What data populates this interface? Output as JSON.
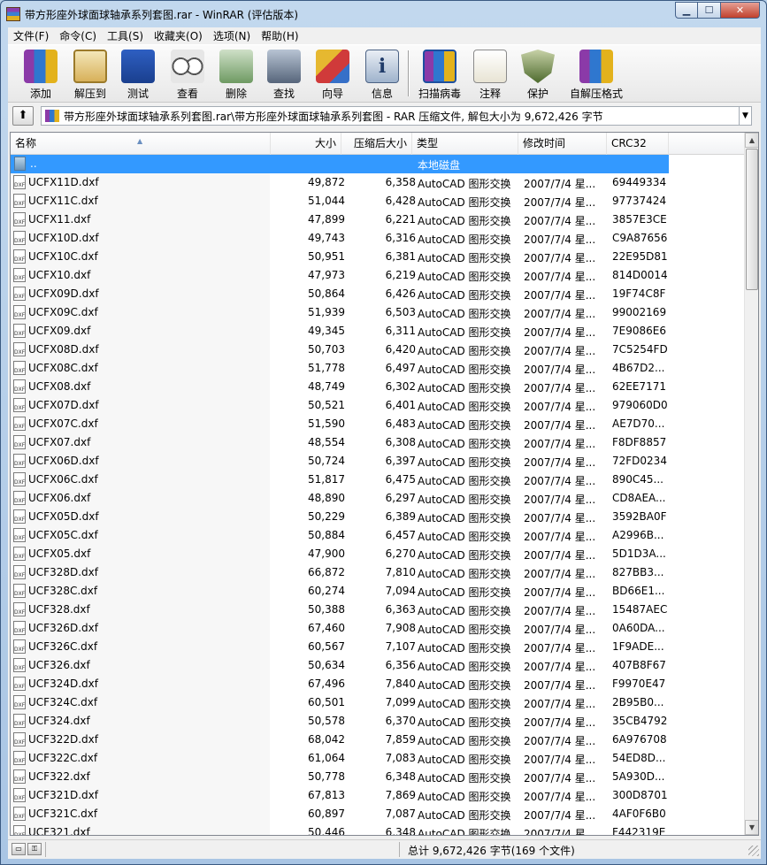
{
  "window": {
    "title": "带方形座外球面球轴承系列套图.rar - WinRAR (评估版本)",
    "controls": {
      "minimize": "▁",
      "maximize": "☐",
      "close": "✕"
    }
  },
  "menu": [
    "文件(F)",
    "命令(C)",
    "工具(S)",
    "收藏夹(O)",
    "选项(N)",
    "帮助(H)"
  ],
  "toolbar": [
    {
      "label": "添加",
      "icon": "add-archive-icon"
    },
    {
      "label": "解压到",
      "icon": "extract-folder-icon"
    },
    {
      "label": "测试",
      "icon": "test-archive-icon"
    },
    {
      "label": "查看",
      "icon": "view-glasses-icon"
    },
    {
      "label": "删除",
      "icon": "delete-recycle-icon"
    },
    {
      "label": "查找",
      "icon": "find-binoculars-icon"
    },
    {
      "label": "向导",
      "icon": "wizard-icon"
    },
    {
      "label": "信息",
      "icon": "info-icon"
    },
    {
      "label": "扫描病毒",
      "icon": "virus-scan-icon"
    },
    {
      "label": "注释",
      "icon": "comment-icon"
    },
    {
      "label": "保护",
      "icon": "protect-shield-icon"
    },
    {
      "label": "自解压格式",
      "icon": "sfx-icon"
    }
  ],
  "address": {
    "up_icon": "up-folder-icon",
    "up_glyph": "⬆",
    "path": "带方形座外球面球轴承系列套图.rar\\带方形座外球面球轴承系列套图 - RAR 压缩文件, 解包大小为 9,672,426 字节",
    "drop_glyph": "▼"
  },
  "columns": {
    "name": "名称",
    "size": "大小",
    "packed": "压缩后大小",
    "type": "类型",
    "modified": "修改时间",
    "crc": "CRC32",
    "sort_glyph": "▲"
  },
  "parent_row": {
    "name": "..",
    "type": "本地磁盘"
  },
  "files": [
    {
      "name": "UCFX11D.dxf",
      "size": "49,872",
      "packed": "6,358",
      "type": "AutoCAD 图形交换",
      "modified": "2007/7/4 星...",
      "crc": "69449334"
    },
    {
      "name": "UCFX11C.dxf",
      "size": "51,044",
      "packed": "6,428",
      "type": "AutoCAD 图形交换",
      "modified": "2007/7/4 星...",
      "crc": "97737424"
    },
    {
      "name": "UCFX11.dxf",
      "size": "47,899",
      "packed": "6,221",
      "type": "AutoCAD 图形交换",
      "modified": "2007/7/4 星...",
      "crc": "3857E3CE"
    },
    {
      "name": "UCFX10D.dxf",
      "size": "49,743",
      "packed": "6,316",
      "type": "AutoCAD 图形交换",
      "modified": "2007/7/4 星...",
      "crc": "C9A87656"
    },
    {
      "name": "UCFX10C.dxf",
      "size": "50,951",
      "packed": "6,381",
      "type": "AutoCAD 图形交换",
      "modified": "2007/7/4 星...",
      "crc": "22E95D81"
    },
    {
      "name": "UCFX10.dxf",
      "size": "47,973",
      "packed": "6,219",
      "type": "AutoCAD 图形交换",
      "modified": "2007/7/4 星...",
      "crc": "814D0014"
    },
    {
      "name": "UCFX09D.dxf",
      "size": "50,864",
      "packed": "6,426",
      "type": "AutoCAD 图形交换",
      "modified": "2007/7/4 星...",
      "crc": "19F74C8F"
    },
    {
      "name": "UCFX09C.dxf",
      "size": "51,939",
      "packed": "6,503",
      "type": "AutoCAD 图形交换",
      "modified": "2007/7/4 星...",
      "crc": "99002169"
    },
    {
      "name": "UCFX09.dxf",
      "size": "49,345",
      "packed": "6,311",
      "type": "AutoCAD 图形交换",
      "modified": "2007/7/4 星...",
      "crc": "7E9086E6"
    },
    {
      "name": "UCFX08D.dxf",
      "size": "50,703",
      "packed": "6,420",
      "type": "AutoCAD 图形交换",
      "modified": "2007/7/4 星...",
      "crc": "7C5254FD"
    },
    {
      "name": "UCFX08C.dxf",
      "size": "51,778",
      "packed": "6,497",
      "type": "AutoCAD 图形交换",
      "modified": "2007/7/4 星...",
      "crc": "4B67D2..."
    },
    {
      "name": "UCFX08.dxf",
      "size": "48,749",
      "packed": "6,302",
      "type": "AutoCAD 图形交换",
      "modified": "2007/7/4 星...",
      "crc": "62EE7171"
    },
    {
      "name": "UCFX07D.dxf",
      "size": "50,521",
      "packed": "6,401",
      "type": "AutoCAD 图形交换",
      "modified": "2007/7/4 星...",
      "crc": "979060D0"
    },
    {
      "name": "UCFX07C.dxf",
      "size": "51,590",
      "packed": "6,483",
      "type": "AutoCAD 图形交换",
      "modified": "2007/7/4 星...",
      "crc": "AE7D70..."
    },
    {
      "name": "UCFX07.dxf",
      "size": "48,554",
      "packed": "6,308",
      "type": "AutoCAD 图形交换",
      "modified": "2007/7/4 星...",
      "crc": "F8DF8857"
    },
    {
      "name": "UCFX06D.dxf",
      "size": "50,724",
      "packed": "6,397",
      "type": "AutoCAD 图形交换",
      "modified": "2007/7/4 星...",
      "crc": "72FD0234"
    },
    {
      "name": "UCFX06C.dxf",
      "size": "51,817",
      "packed": "6,475",
      "type": "AutoCAD 图形交换",
      "modified": "2007/7/4 星...",
      "crc": "890C45..."
    },
    {
      "name": "UCFX06.dxf",
      "size": "48,890",
      "packed": "6,297",
      "type": "AutoCAD 图形交换",
      "modified": "2007/7/4 星...",
      "crc": "CD8AEA..."
    },
    {
      "name": "UCFX05D.dxf",
      "size": "50,229",
      "packed": "6,389",
      "type": "AutoCAD 图形交换",
      "modified": "2007/7/4 星...",
      "crc": "3592BA0F"
    },
    {
      "name": "UCFX05C.dxf",
      "size": "50,884",
      "packed": "6,457",
      "type": "AutoCAD 图形交换",
      "modified": "2007/7/4 星...",
      "crc": "A2996B..."
    },
    {
      "name": "UCFX05.dxf",
      "size": "47,900",
      "packed": "6,270",
      "type": "AutoCAD 图形交换",
      "modified": "2007/7/4 星...",
      "crc": "5D1D3A..."
    },
    {
      "name": "UCF328D.dxf",
      "size": "66,872",
      "packed": "7,810",
      "type": "AutoCAD 图形交换",
      "modified": "2007/7/4 星...",
      "crc": "827BB3..."
    },
    {
      "name": "UCF328C.dxf",
      "size": "60,274",
      "packed": "7,094",
      "type": "AutoCAD 图形交换",
      "modified": "2007/7/4 星...",
      "crc": "BD66E1..."
    },
    {
      "name": "UCF328.dxf",
      "size": "50,388",
      "packed": "6,363",
      "type": "AutoCAD 图形交换",
      "modified": "2007/7/4 星...",
      "crc": "15487AEC"
    },
    {
      "name": "UCF326D.dxf",
      "size": "67,460",
      "packed": "7,908",
      "type": "AutoCAD 图形交换",
      "modified": "2007/7/4 星...",
      "crc": "0A60DA..."
    },
    {
      "name": "UCF326C.dxf",
      "size": "60,567",
      "packed": "7,107",
      "type": "AutoCAD 图形交换",
      "modified": "2007/7/4 星...",
      "crc": "1F9ADE..."
    },
    {
      "name": "UCF326.dxf",
      "size": "50,634",
      "packed": "6,356",
      "type": "AutoCAD 图形交换",
      "modified": "2007/7/4 星...",
      "crc": "407B8F67"
    },
    {
      "name": "UCF324D.dxf",
      "size": "67,496",
      "packed": "7,840",
      "type": "AutoCAD 图形交换",
      "modified": "2007/7/4 星...",
      "crc": "F9970E47"
    },
    {
      "name": "UCF324C.dxf",
      "size": "60,501",
      "packed": "7,099",
      "type": "AutoCAD 图形交换",
      "modified": "2007/7/4 星...",
      "crc": "2B95B0..."
    },
    {
      "name": "UCF324.dxf",
      "size": "50,578",
      "packed": "6,370",
      "type": "AutoCAD 图形交换",
      "modified": "2007/7/4 星...",
      "crc": "35CB4792"
    },
    {
      "name": "UCF322D.dxf",
      "size": "68,042",
      "packed": "7,859",
      "type": "AutoCAD 图形交换",
      "modified": "2007/7/4 星...",
      "crc": "6A976708"
    },
    {
      "name": "UCF322C.dxf",
      "size": "61,064",
      "packed": "7,083",
      "type": "AutoCAD 图形交换",
      "modified": "2007/7/4 星...",
      "crc": "54ED8D..."
    },
    {
      "name": "UCF322.dxf",
      "size": "50,778",
      "packed": "6,348",
      "type": "AutoCAD 图形交换",
      "modified": "2007/7/4 星...",
      "crc": "5A930D..."
    },
    {
      "name": "UCF321D.dxf",
      "size": "67,813",
      "packed": "7,869",
      "type": "AutoCAD 图形交换",
      "modified": "2007/7/4 星...",
      "crc": "300D8701"
    },
    {
      "name": "UCF321C.dxf",
      "size": "60,897",
      "packed": "7,087",
      "type": "AutoCAD 图形交换",
      "modified": "2007/7/4 星...",
      "crc": "4AF0F6B0"
    },
    {
      "name": "UCF321.dxf",
      "size": "50,446",
      "packed": "6,348",
      "type": "AutoCAD 图形交换",
      "modified": "2007/7/4 星...",
      "crc": "F442319E"
    }
  ],
  "file_icon_text": "DXF",
  "scrollbar": {
    "up": "▲",
    "down": "▼"
  },
  "status": {
    "text": "总计 9,672,426 字节(169 个文件)",
    "drive_icon": "drive-icon",
    "key_icon": "key-icon"
  },
  "colors": {
    "selection": "#3399ff",
    "title_bg": "#c2d8ee"
  }
}
